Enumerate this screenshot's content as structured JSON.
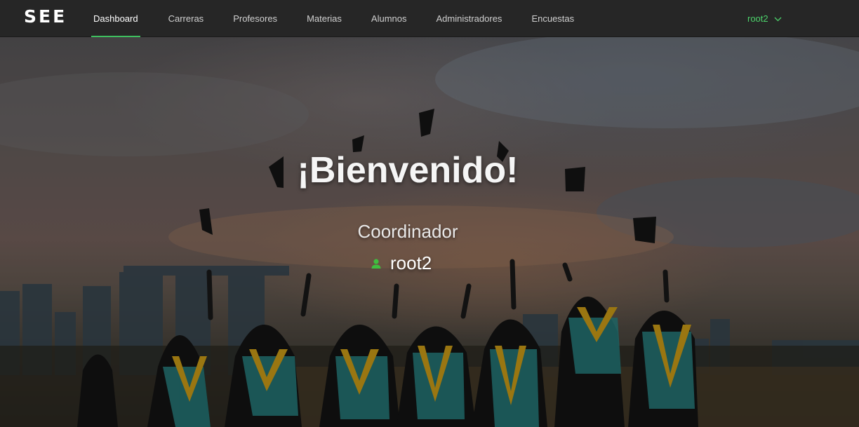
{
  "nav": {
    "brand": "SEE",
    "items": [
      {
        "label": "Dashboard",
        "active": true
      },
      {
        "label": "Carreras",
        "active": false
      },
      {
        "label": "Profesores",
        "active": false
      },
      {
        "label": "Materias",
        "active": false
      },
      {
        "label": "Alumnos",
        "active": false
      },
      {
        "label": "Administradores",
        "active": false
      },
      {
        "label": "Encuestas",
        "active": false
      }
    ],
    "user": {
      "label": "root2",
      "icon": "chevron-down-icon"
    }
  },
  "hero": {
    "title": "¡Bienvenido!",
    "role": "Coordinador",
    "username": "root2",
    "user_icon": "person-icon",
    "background": "graduation-photo"
  },
  "colors": {
    "accent": "#3fbf5f",
    "user_menu": "#4cd26b",
    "navbar": "#262626"
  }
}
